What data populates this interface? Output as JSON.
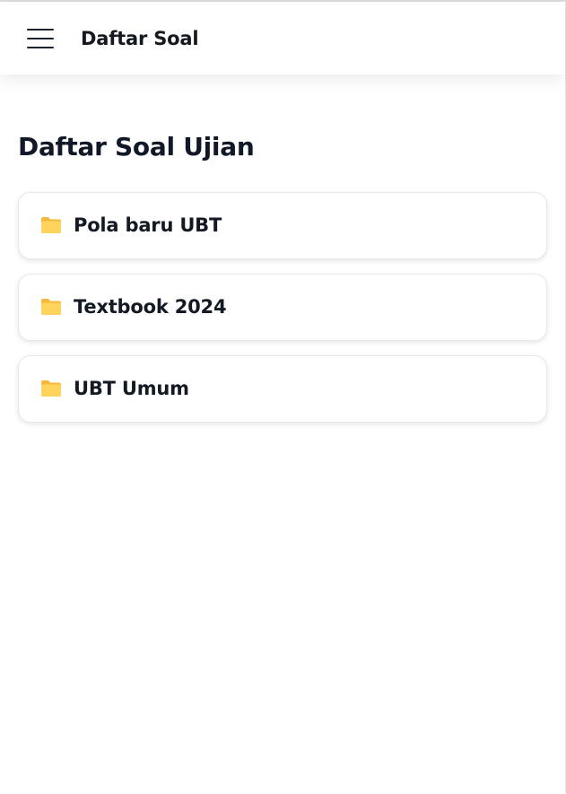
{
  "appbar": {
    "title": "Daftar Soal",
    "menu_icon": "hamburger-menu-icon"
  },
  "main": {
    "heading": "Daftar Soal Ujian",
    "folders": [
      {
        "label": "Pola baru UBT",
        "icon": "folder-icon"
      },
      {
        "label": "Textbook 2024",
        "icon": "folder-icon"
      },
      {
        "label": "UBT Umum",
        "icon": "folder-icon"
      }
    ]
  },
  "colors": {
    "folder_front": "#ffd35c",
    "folder_back": "#f4b93a",
    "text_primary": "#111827"
  }
}
